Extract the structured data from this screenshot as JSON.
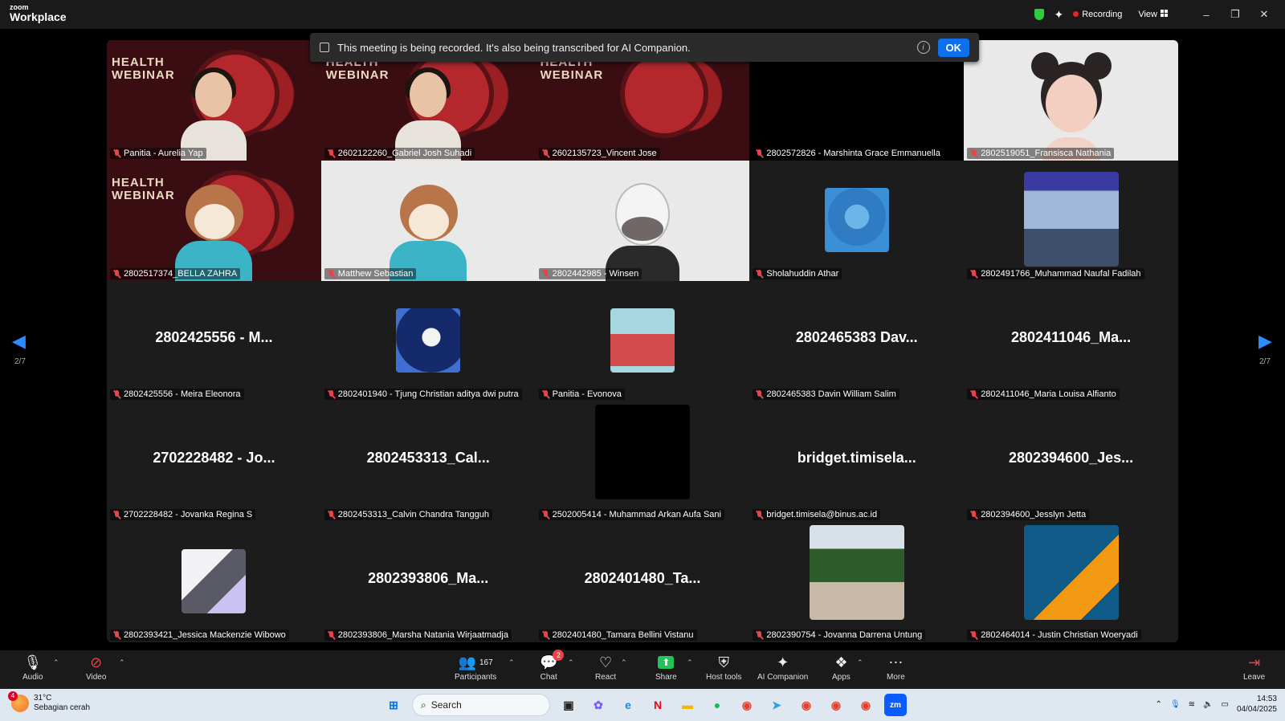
{
  "app": {
    "brand_small": "zoom",
    "brand_large": "Workplace"
  },
  "topbar": {
    "recording_label": "Recording",
    "view_label": "View",
    "min": "–",
    "restore": "❐",
    "close": "✕"
  },
  "banner": {
    "message": "This meeting is being recorded. It's also being transcribed for AI Companion.",
    "ok_label": "OK",
    "info": "i"
  },
  "navigation": {
    "prev_arrow": "◀",
    "next_arrow": "▶",
    "page_left": "2/7",
    "page_right": "2/7"
  },
  "tiles": [
    {
      "name": "Panitia - Aurelia Yap",
      "kind": "webinar-person"
    },
    {
      "name": "2602122260_Gabriel Josh Suhadi",
      "kind": "webinar-person"
    },
    {
      "name": "2602135723_Vincent Jose",
      "kind": "webinar"
    },
    {
      "name": "2802572826 - Marshinta Grace Emmanuella",
      "kind": "black"
    },
    {
      "name": "2802519051_Fransisca Nathania",
      "kind": "avatar-girl"
    },
    {
      "name": "2802517374_BELLA ZAHRA",
      "kind": "webinar-dog"
    },
    {
      "name": "Matthew Sebastian",
      "kind": "avatar-dog"
    },
    {
      "name": "2802442985 - Winsen",
      "kind": "avatar-cow"
    },
    {
      "name": "Sholahuddin Athar",
      "kind": "thumb-blue"
    },
    {
      "name": "2802491766_Muhammad Naufal Fadilah",
      "kind": "thumb-photo"
    },
    {
      "name": "2802425556 - Meira Eleonora",
      "kind": "text",
      "big": "2802425556 - M..."
    },
    {
      "name": "2802401940 - Tjung Christian aditya dwi putra",
      "kind": "thumb-astronaut"
    },
    {
      "name": "Panitia - Evonova",
      "kind": "thumb-lady"
    },
    {
      "name": "2802465383 Davin William Salim",
      "kind": "text",
      "big": "2802465383 Dav..."
    },
    {
      "name": "2802411046_Maria Louisa Alfianto",
      "kind": "text",
      "big": "2802411046_Ma..."
    },
    {
      "name": "2702228482 - Jovanka Regina S",
      "kind": "text",
      "big": "2702228482 - Jo..."
    },
    {
      "name": "2802453313_Calvin Chandra Tangguh",
      "kind": "text",
      "big": "2802453313_Cal..."
    },
    {
      "name": "2502005414 - Muhammad Arkan Aufa Sani",
      "kind": "thumb-dark"
    },
    {
      "name": "bridget.timisela@binus.ac.id",
      "kind": "text",
      "big": "bridget.timisela..."
    },
    {
      "name": "2802394600_Jesslyn Jetta",
      "kind": "text",
      "big": "2802394600_Jes..."
    },
    {
      "name": "2802393421_Jessica Mackenzie Wibowo",
      "kind": "thumb-laptop"
    },
    {
      "name": "2802393806_Marsha Natania Wirjaatmadja",
      "kind": "text",
      "big": "2802393806_Ma..."
    },
    {
      "name": "2802401480_Tamara Bellini Vistanu",
      "kind": "text",
      "big": "2802401480_Ta..."
    },
    {
      "name": "2802390754 - Jovanna Darrena Untung",
      "kind": "thumb-park"
    },
    {
      "name": "2802464014 - Justin Christian Woeryadi",
      "kind": "thumb-orange"
    }
  ],
  "webinar_text": "HEALTH WEBINAR",
  "toolbar": {
    "audio": "Audio",
    "video": "Video",
    "participants": "Participants",
    "participants_count": "167",
    "chat": "Chat",
    "chat_badge": "2",
    "react": "React",
    "share": "Share",
    "host_tools": "Host tools",
    "ai_companion": "AI Companion",
    "apps": "Apps",
    "more": "More",
    "leave": "Leave"
  },
  "taskbar": {
    "weather_temp": "31°C",
    "weather_desc": "Sebagian cerah",
    "weather_badge": "4",
    "search_placeholder": "Search",
    "time": "14:53",
    "date": "04/04/2025"
  }
}
